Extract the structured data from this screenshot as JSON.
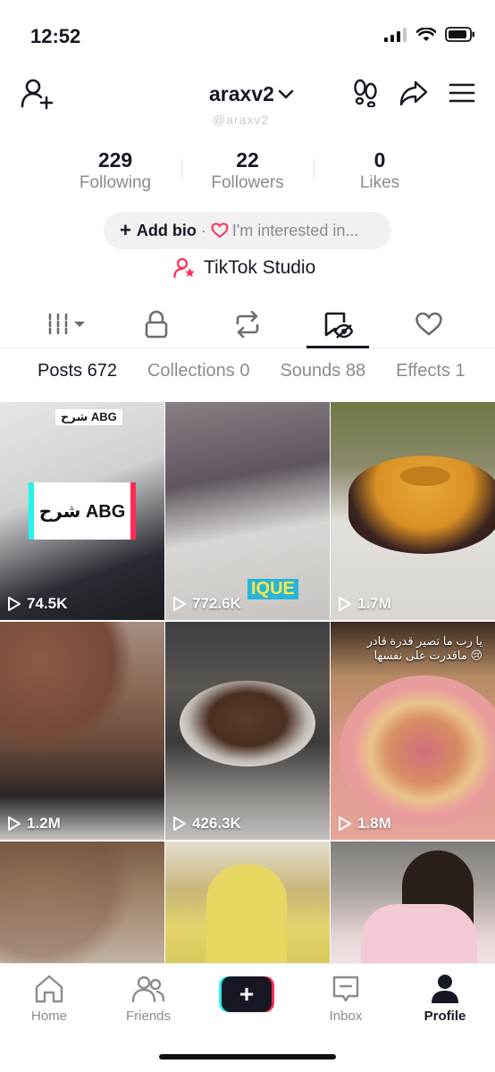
{
  "status_bar": {
    "time": "12:52"
  },
  "header": {
    "username": "araxv2",
    "ghost_handle": "@araxv2"
  },
  "stats": [
    {
      "value": "229",
      "label": "Following"
    },
    {
      "value": "22",
      "label": "Followers"
    },
    {
      "value": "0",
      "label": "Likes"
    }
  ],
  "bio": {
    "plus": "+",
    "add_bio": "Add bio",
    "separator": "·",
    "interest": "I'm interested in..."
  },
  "studio": {
    "label": "TikTok Studio"
  },
  "subtabs": [
    "Posts 672",
    "Collections 0",
    "Sounds 88",
    "Effects 1"
  ],
  "grid": {
    "tiles": [
      {
        "views": "74.5K",
        "tag": "شرح ABG",
        "card": "شرح ABG"
      },
      {
        "views": "772.6K",
        "overlay": "IQUE"
      },
      {
        "views": "1.7M"
      },
      {
        "views": "1.2M"
      },
      {
        "views": "426.3K"
      },
      {
        "views": "1.8M",
        "overlay": "يا رب ما تصير قدرة قادر\nماقدرت على نفسها 😢"
      },
      {
        "views": ""
      },
      {
        "views": ""
      },
      {
        "views": ""
      }
    ]
  },
  "bottom_nav": {
    "home": "Home",
    "friends": "Friends",
    "create": "+",
    "inbox": "Inbox",
    "profile": "Profile"
  },
  "colors": {
    "accent_red": "#fe2c55",
    "accent_cyan": "#25f4ee",
    "text": "#161823",
    "muted": "#8a8b91"
  }
}
